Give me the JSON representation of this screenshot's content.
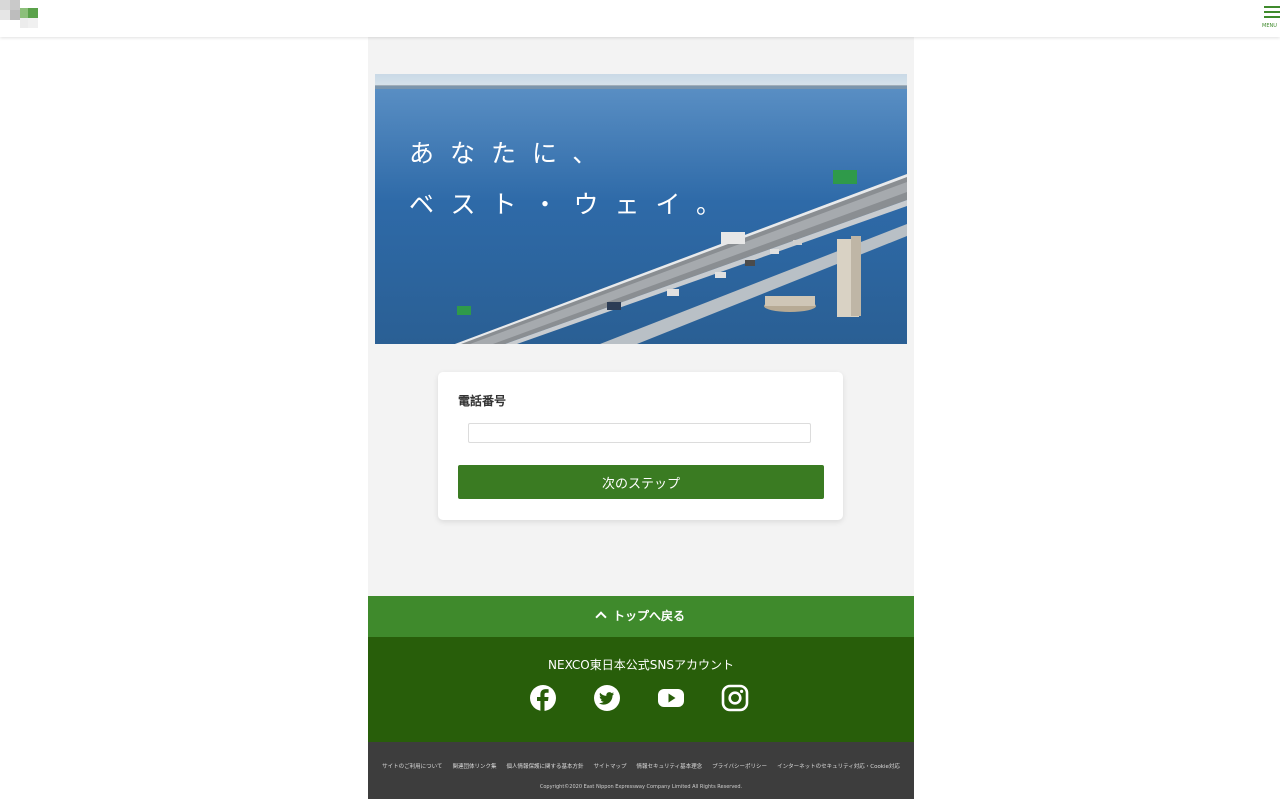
{
  "header": {
    "menu_label": "MENU"
  },
  "hero": {
    "line1": "あなたに、",
    "line2": "ベスト・ウェイ。"
  },
  "form": {
    "phone_label": "電話番号",
    "phone_value": "",
    "next_button": "次のステップ"
  },
  "back_to_top": "トップへ戻る",
  "sns": {
    "title": "NEXCO東日本公式SNSアカウント",
    "icons": [
      "facebook-icon",
      "twitter-icon",
      "youtube-icon",
      "instagram-icon"
    ]
  },
  "footer": {
    "links": [
      "サイトのご利用について",
      "関連団体リンク集",
      "個人情報保護に関する基本方針",
      "サイトマップ",
      "情報セキュリティ基本理念",
      "プライバシーポリシー",
      "インターネットのセキュリティ対応・Cookie対応"
    ],
    "copyright": "Copyright©2020 East Nippon Expressway Company Limited All Rights Reserved."
  },
  "colors": {
    "brand_green": "#3f8a2c",
    "button_green": "#3a7b22",
    "dark_green": "#285e0a",
    "footer_gray": "#3d3d3d"
  }
}
